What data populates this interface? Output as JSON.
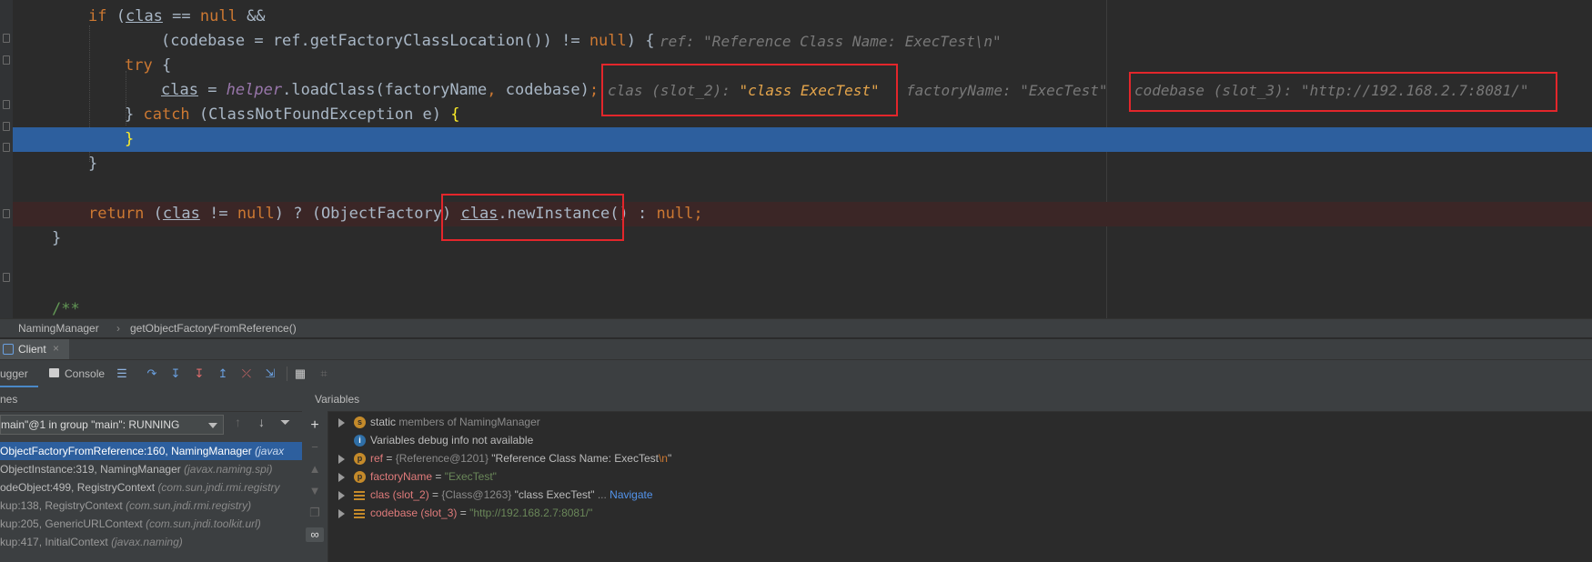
{
  "editor": {
    "lines": {
      "l1_if": "if",
      "l1_a": " (",
      "l1_clas": "clas",
      "l1_b": " == ",
      "l1_null": "null",
      "l1_c": " &&",
      "l2_a": "(codebase = ref.getFactoryClassLocation()) != ",
      "l2_null": "null",
      "l2_b": ") {",
      "l2_hint_label": "ref: ",
      "l2_hint_value": "\"Reference Class Name: ExecTest\\n\"",
      "l3_try": "try",
      "l3_b": " {",
      "l4_clas": "clas",
      "l4_a": " = ",
      "l4_helper": "helper",
      "l4_b": ".loadClass(factoryName",
      "l4_comma": ",",
      "l4_c": " codebase)",
      "l4_semi": ";",
      "l4_hint1_label": "clas (slot_2): ",
      "l4_hint1_value": "\"class ExecTest\"",
      "l4_hint2_label": "factoryName: ",
      "l4_hint2_value": "\"ExecTest\"",
      "l4_hint3_label": "codebase (slot_3): ",
      "l4_hint3_value": "\"http://192.168.2.7:8081/\"",
      "l5_a": "} ",
      "l5_catch": "catch",
      "l5_b": " (ClassNotFoundException e) ",
      "l5_brace": "{",
      "l6_brace": "}",
      "l7_brace": "}",
      "l8_return": "return",
      "l8_a": " (",
      "l8_clas": "clas",
      "l8_b": " != ",
      "l8_null": "null",
      "l8_c": ") ? (ObjectFactory) ",
      "l8_clas2": "clas",
      "l8_d": ".newInstance() ",
      "l8_e": ": ",
      "l8_null2": "null;",
      "l9_brace": "}",
      "l10_comment": "/**"
    }
  },
  "breadcrumb": {
    "class_name": "NamingManager",
    "separator": "›",
    "method_name": "getObjectFactoryFromReference()"
  },
  "debug": {
    "tab_label": "Client",
    "tab_close": "×",
    "debugger_tab": "ugger",
    "console_tab": "Console",
    "frames_header": "nes",
    "thread_select": "main\"@1 in group \"main\": RUNNING",
    "variables_header": "Variables",
    "frames": [
      {
        "text": "ObjectFactoryFromReference:160, NamingManager ",
        "pkg": "(javax"
      },
      {
        "text": "ObjectInstance:319, NamingManager ",
        "pkg": "(javax.naming.spi)"
      },
      {
        "text": "odeObject:499, RegistryContext ",
        "pkg": "(com.sun.jndi.rmi.registry"
      },
      {
        "text": "kup:138, RegistryContext ",
        "pkg": "(com.sun.jndi.rmi.registry)"
      },
      {
        "text": "kup:205, GenericURLContext ",
        "pkg": "(com.sun.jndi.toolkit.url)"
      },
      {
        "text": "kup:417, InitialContext ",
        "pkg": "(javax.naming)"
      }
    ],
    "variables": {
      "v0_badge": "s",
      "v0_label": "static",
      "v0_desc": " members of NamingManager",
      "v1_badge": "i",
      "v1_text": "Variables debug info not available",
      "v2_badge": "p",
      "v2_name": "ref",
      "v2_eq": " = ",
      "v2_type": "{Reference@1201} ",
      "v2_value": "\"Reference Class Name: ExecTest",
      "v2_esc": "\\n",
      "v2_close": "\"",
      "v3_badge": "p",
      "v3_name": "factoryName",
      "v3_eq": " = ",
      "v3_value": "\"ExecTest\"",
      "v4_name": "clas (slot_2)",
      "v4_eq": " = ",
      "v4_type": "{Class@1263} ",
      "v4_value": "\"class ExecTest\"",
      "v4_more": " ... ",
      "v4_nav": "Navigate",
      "v5_name": "codebase (slot_3)",
      "v5_eq": " = ",
      "v5_value": "\"http://192.168.2.7:8081/\""
    }
  },
  "colors": {
    "editor_bg": "#2b2b2b",
    "exec_line": "#2d5f9e",
    "breakpoint_line": "#3b2626",
    "keyword": "#cc7832",
    "highlight_box": "#e3262b"
  }
}
